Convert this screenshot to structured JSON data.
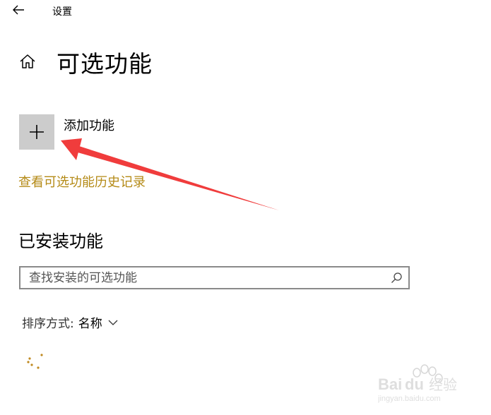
{
  "window": {
    "title": "设置"
  },
  "header": {
    "page_title": "可选功能"
  },
  "add_feature": {
    "label": "添加功能"
  },
  "history_link": {
    "label": "查看可选功能历史记录",
    "color": "#b48a16"
  },
  "installed": {
    "heading": "已安装功能",
    "search": {
      "placeholder": "查找安装的可选功能",
      "value": ""
    },
    "sort": {
      "label": "排序方式:",
      "value": "名称"
    }
  },
  "annotation": {
    "arrow_color": "#f03c3c"
  },
  "watermark": {
    "brand": "Baidu经验",
    "url": "jingyan.baidu.com"
  },
  "icons": {
    "back": "back-arrow-icon",
    "home": "home-icon",
    "add": "plus-icon",
    "search": "search-icon",
    "sort": "chevron-down-icon",
    "loading": "loading-spinner-icon"
  }
}
